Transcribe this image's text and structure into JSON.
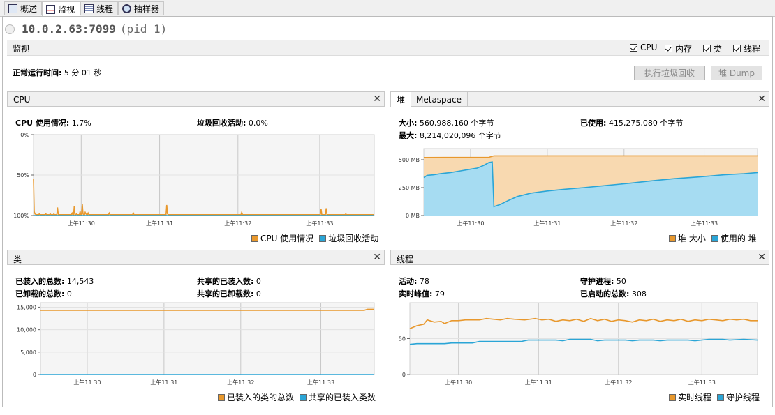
{
  "tabs": [
    {
      "label": "概述",
      "icon": "overview-icon"
    },
    {
      "label": "监视",
      "icon": "monitor-icon"
    },
    {
      "label": "线程",
      "icon": "threads-icon"
    },
    {
      "label": "抽样器",
      "icon": "sampler-icon"
    }
  ],
  "header": {
    "host": "10.0.2.63:7099",
    "pid": "(pid 1)"
  },
  "monitor": {
    "label": "监视",
    "checkboxes": [
      "CPU",
      "内存",
      "类",
      "线程"
    ],
    "uptime_label": "正常运行时间:",
    "uptime_value": "5 分 01 秒",
    "gc_button": "执行垃圾回收",
    "heap_dump_button": "堆 Dump"
  },
  "colors": {
    "orange": "#e8982d",
    "blue": "#2aa5d6",
    "orange_fill": "#f8d9b0",
    "blue_fill": "#a6dcf2"
  },
  "cpu": {
    "title": "CPU",
    "usage_label": "CPU 使用情况:",
    "usage_value": "1.7%",
    "gc_label": "垃圾回收活动:",
    "gc_value": "0.0%",
    "legend": [
      "CPU 使用情况",
      "垃圾回收活动"
    ]
  },
  "heap": {
    "tab_heap": "堆",
    "tab_meta": "Metaspace",
    "size_label": "大小:",
    "size_value": "560,988,160 个字节",
    "used_label": "已使用:",
    "used_value": "415,275,080 个字节",
    "max_label": "最大:",
    "max_value": "8,214,020,096 个字节",
    "legend": [
      "堆 大小",
      "使用的 堆"
    ]
  },
  "classes": {
    "title": "类",
    "loaded_label": "已装入的总数:",
    "loaded_value": "14,543",
    "unloaded_label": "已卸载的总数:",
    "unloaded_value": "0",
    "shared_loaded_label": "共享的已装入数:",
    "shared_loaded_value": "0",
    "shared_unloaded_label": "共享的已卸载数:",
    "shared_unloaded_value": "0",
    "legend": [
      "已装入的类的总数",
      "共享的已装入类数"
    ]
  },
  "threads": {
    "title": "线程",
    "live_label": "活动:",
    "live_value": "78",
    "peak_label": "实时峰值:",
    "peak_value": "79",
    "daemon_label": "守护进程:",
    "daemon_value": "50",
    "started_label": "已启动的总数:",
    "started_value": "308",
    "legend": [
      "实时线程",
      "守护线程"
    ]
  },
  "chart_data": [
    {
      "type": "line",
      "name": "cpu",
      "x_ticks": [
        "上午11:30",
        "上午11:31",
        "上午11:32",
        "上午11:33"
      ],
      "y_ticks": [
        "100%",
        "50%",
        "0%"
      ],
      "ylim": [
        0,
        100
      ],
      "series": [
        {
          "name": "CPU 使用情况",
          "color": "#e8982d",
          "values": [
            45,
            5,
            2,
            1.5,
            1,
            1,
            1,
            1,
            2,
            1,
            1,
            1,
            1,
            1,
            1,
            1,
            1,
            2,
            1,
            1,
            1,
            1,
            1,
            2,
            1,
            1,
            1,
            1,
            2,
            1,
            1,
            1,
            1,
            10,
            1,
            1,
            1,
            1,
            1,
            1,
            1,
            1,
            1,
            1,
            1,
            1,
            1,
            1,
            1,
            1,
            1,
            1,
            1,
            3,
            1,
            1,
            12,
            1,
            1,
            2,
            1,
            1,
            1,
            1,
            5,
            1,
            1,
            14,
            2,
            1,
            1,
            4,
            2,
            1,
            1,
            3,
            1,
            1,
            1,
            1,
            1,
            1,
            1,
            1,
            1,
            1,
            1,
            1,
            1,
            1,
            1,
            1,
            1,
            1,
            1,
            1,
            1,
            1,
            1,
            1,
            1,
            1,
            1,
            1,
            3,
            1,
            1,
            1,
            1,
            1,
            1,
            1,
            1,
            1,
            1,
            1,
            1,
            1,
            1,
            1,
            1,
            1,
            1,
            1,
            1,
            1,
            1,
            1,
            1,
            1,
            1,
            1,
            1,
            1,
            1,
            1,
            1,
            3,
            1,
            1,
            1,
            1,
            1,
            1,
            1,
            1,
            1,
            1,
            1,
            1,
            1,
            1,
            1,
            1,
            1,
            1,
            1,
            1,
            1,
            1,
            1,
            1,
            1,
            1,
            1,
            1,
            1,
            1,
            1,
            1,
            1,
            1,
            1,
            1,
            1,
            1,
            1,
            1,
            1,
            1,
            1,
            1,
            1,
            13,
            2,
            1,
            1,
            1,
            1,
            1,
            1,
            1,
            1,
            1,
            1,
            1,
            1,
            1,
            1,
            1,
            1,
            1,
            1,
            1,
            1,
            1,
            1,
            1,
            1,
            1,
            1,
            1,
            1,
            1,
            1,
            1,
            1,
            1,
            1,
            1,
            1,
            1,
            1,
            1,
            1,
            1,
            1,
            1,
            1,
            1,
            1,
            1,
            1,
            1,
            1,
            1,
            1,
            1,
            1,
            1,
            1,
            1,
            1,
            1,
            1,
            1,
            1,
            1,
            1,
            1,
            1,
            1,
            1,
            1,
            1,
            1,
            1,
            1,
            1,
            1,
            1,
            1,
            1,
            1,
            1,
            1,
            1,
            1,
            1,
            1,
            1,
            1,
            1,
            1,
            1,
            1,
            1,
            1,
            1,
            1,
            1,
            1,
            1,
            1,
            1,
            1,
            4,
            1,
            1,
            1,
            1,
            1,
            1,
            1,
            1,
            1,
            1,
            1,
            1,
            1,
            1,
            1,
            1,
            1,
            1,
            1,
            1,
            1,
            1,
            1,
            1,
            1,
            1,
            1,
            1,
            1,
            1,
            1,
            1,
            1,
            1,
            1,
            1,
            1,
            1,
            1,
            1,
            1,
            1,
            1,
            1,
            1,
            1,
            1,
            1,
            1,
            1,
            1,
            1,
            1,
            1,
            1,
            1,
            1,
            1,
            1,
            1,
            1,
            1,
            1,
            1,
            1,
            1,
            1,
            1,
            1,
            1,
            1,
            1,
            1,
            1,
            1,
            1,
            1,
            1,
            1,
            1,
            1,
            1,
            1,
            1,
            1,
            1,
            1,
            1,
            1,
            1,
            1,
            1,
            1,
            1,
            1,
            1,
            1,
            1,
            1,
            1,
            1,
            1,
            1,
            1,
            1,
            1,
            1,
            1,
            8,
            1,
            1,
            1,
            1,
            1,
            1,
            9,
            1,
            1,
            1,
            1,
            1,
            1,
            1,
            1,
            1,
            1,
            1,
            1,
            1,
            1,
            1,
            1,
            1,
            1,
            1,
            1,
            1,
            1,
            1,
            1,
            1,
            1,
            2,
            1,
            1,
            1,
            1,
            1,
            1,
            1,
            1,
            1,
            1,
            1,
            1,
            1,
            1,
            1,
            1,
            1,
            1,
            1,
            1,
            1,
            1,
            1,
            1,
            1,
            1,
            1,
            1,
            1,
            1,
            1,
            1,
            1,
            1,
            1,
            1,
            1,
            1,
            1
          ]
        },
        {
          "name": "垃圾回收活动",
          "color": "#2aa5d6",
          "values": [
            0,
            0
          ]
        }
      ]
    },
    {
      "type": "area",
      "name": "heap",
      "x_ticks": [
        "上午11:30",
        "上午11:31",
        "上午11:32",
        "上午11:33"
      ],
      "y_ticks": [
        "500 MB",
        "250 MB",
        "0 MB"
      ],
      "ylim": [
        0,
        600
      ],
      "series": [
        {
          "name": "堆 大小",
          "color": "#e8982d",
          "points": [
            [
              0,
              520
            ],
            [
              0.195,
              522
            ],
            [
              0.21,
              535
            ],
            [
              1,
              535
            ]
          ]
        },
        {
          "name": "使用的 堆",
          "color": "#2aa5d6",
          "points": [
            [
              0,
              340
            ],
            [
              0.01,
              360
            ],
            [
              0.03,
              365
            ],
            [
              0.05,
              375
            ],
            [
              0.08,
              385
            ],
            [
              0.11,
              400
            ],
            [
              0.14,
              415
            ],
            [
              0.16,
              425
            ],
            [
              0.18,
              450
            ],
            [
              0.195,
              475
            ],
            [
              0.205,
              480
            ],
            [
              0.21,
              80
            ],
            [
              0.23,
              100
            ],
            [
              0.25,
              130
            ],
            [
              0.28,
              170
            ],
            [
              0.32,
              200
            ],
            [
              0.37,
              220
            ],
            [
              0.42,
              235
            ],
            [
              0.48,
              250
            ],
            [
              0.55,
              270
            ],
            [
              0.62,
              290
            ],
            [
              0.68,
              310
            ],
            [
              0.75,
              330
            ],
            [
              0.82,
              345
            ],
            [
              0.9,
              365
            ],
            [
              0.96,
              375
            ],
            [
              1,
              385
            ]
          ]
        }
      ]
    },
    {
      "type": "line",
      "name": "classes",
      "x_ticks": [
        "上午11:30",
        "上午11:31",
        "上午11:32",
        "上午11:33"
      ],
      "y_ticks": [
        "15,000",
        "10,000",
        "5,000",
        "0"
      ],
      "ylim": [
        0,
        16000
      ],
      "series": [
        {
          "name": "已装入的类的总数",
          "color": "#e8982d",
          "points": [
            [
              0,
              14300
            ],
            [
              0.97,
              14300
            ],
            [
              0.98,
              14543
            ],
            [
              1,
              14543
            ]
          ]
        },
        {
          "name": "共享的已装入类数",
          "color": "#2aa5d6",
          "points": [
            [
              0,
              0
            ],
            [
              1,
              0
            ]
          ]
        }
      ]
    },
    {
      "type": "line",
      "name": "threads",
      "x_ticks": [
        "上午11:30",
        "上午11:31",
        "上午11:32",
        "上午11:33"
      ],
      "y_ticks": [
        "50",
        "0"
      ],
      "ylim": [
        0,
        100
      ],
      "series": [
        {
          "name": "实时线程",
          "color": "#e8982d",
          "points": [
            [
              0,
              64
            ],
            [
              0.02,
              68
            ],
            [
              0.04,
              70
            ],
            [
              0.05,
              76
            ],
            [
              0.07,
              73
            ],
            [
              0.09,
              74
            ],
            [
              0.1,
              71
            ],
            [
              0.12,
              75
            ],
            [
              0.14,
              75
            ],
            [
              0.16,
              76
            ],
            [
              0.2,
              76
            ],
            [
              0.22,
              78
            ],
            [
              0.24,
              77
            ],
            [
              0.26,
              76
            ],
            [
              0.28,
              78
            ],
            [
              0.3,
              77
            ],
            [
              0.33,
              76
            ],
            [
              0.36,
              78
            ],
            [
              0.38,
              76
            ],
            [
              0.4,
              77
            ],
            [
              0.42,
              74
            ],
            [
              0.44,
              76
            ],
            [
              0.46,
              75
            ],
            [
              0.48,
              77
            ],
            [
              0.5,
              74
            ],
            [
              0.52,
              78
            ],
            [
              0.54,
              75
            ],
            [
              0.56,
              77
            ],
            [
              0.58,
              74
            ],
            [
              0.6,
              76
            ],
            [
              0.62,
              75
            ],
            [
              0.64,
              73
            ],
            [
              0.66,
              76
            ],
            [
              0.68,
              75
            ],
            [
              0.7,
              77
            ],
            [
              0.72,
              74
            ],
            [
              0.74,
              76
            ],
            [
              0.76,
              75
            ],
            [
              0.78,
              77
            ],
            [
              0.8,
              74
            ],
            [
              0.82,
              76
            ],
            [
              0.84,
              75
            ],
            [
              0.86,
              77
            ],
            [
              0.88,
              76
            ],
            [
              0.9,
              75
            ],
            [
              0.92,
              77
            ],
            [
              0.94,
              76
            ],
            [
              0.96,
              77
            ],
            [
              0.98,
              75
            ],
            [
              1,
              75
            ]
          ]
        },
        {
          "name": "守护线程",
          "color": "#2aa5d6",
          "points": [
            [
              0,
              42
            ],
            [
              0.02,
              43
            ],
            [
              0.1,
              43
            ],
            [
              0.12,
              44
            ],
            [
              0.18,
              44
            ],
            [
              0.2,
              46
            ],
            [
              0.32,
              46
            ],
            [
              0.34,
              48
            ],
            [
              0.42,
              48
            ],
            [
              0.44,
              47
            ],
            [
              0.46,
              49
            ],
            [
              0.52,
              49
            ],
            [
              0.54,
              47
            ],
            [
              0.56,
              48
            ],
            [
              0.62,
              48
            ],
            [
              0.64,
              47
            ],
            [
              0.66,
              48
            ],
            [
              0.7,
              48
            ],
            [
              0.72,
              47
            ],
            [
              0.74,
              48
            ],
            [
              0.8,
              48
            ],
            [
              0.82,
              47
            ],
            [
              0.86,
              49
            ],
            [
              0.9,
              49
            ],
            [
              0.92,
              48
            ],
            [
              0.96,
              49
            ],
            [
              1,
              48
            ]
          ]
        }
      ]
    }
  ]
}
